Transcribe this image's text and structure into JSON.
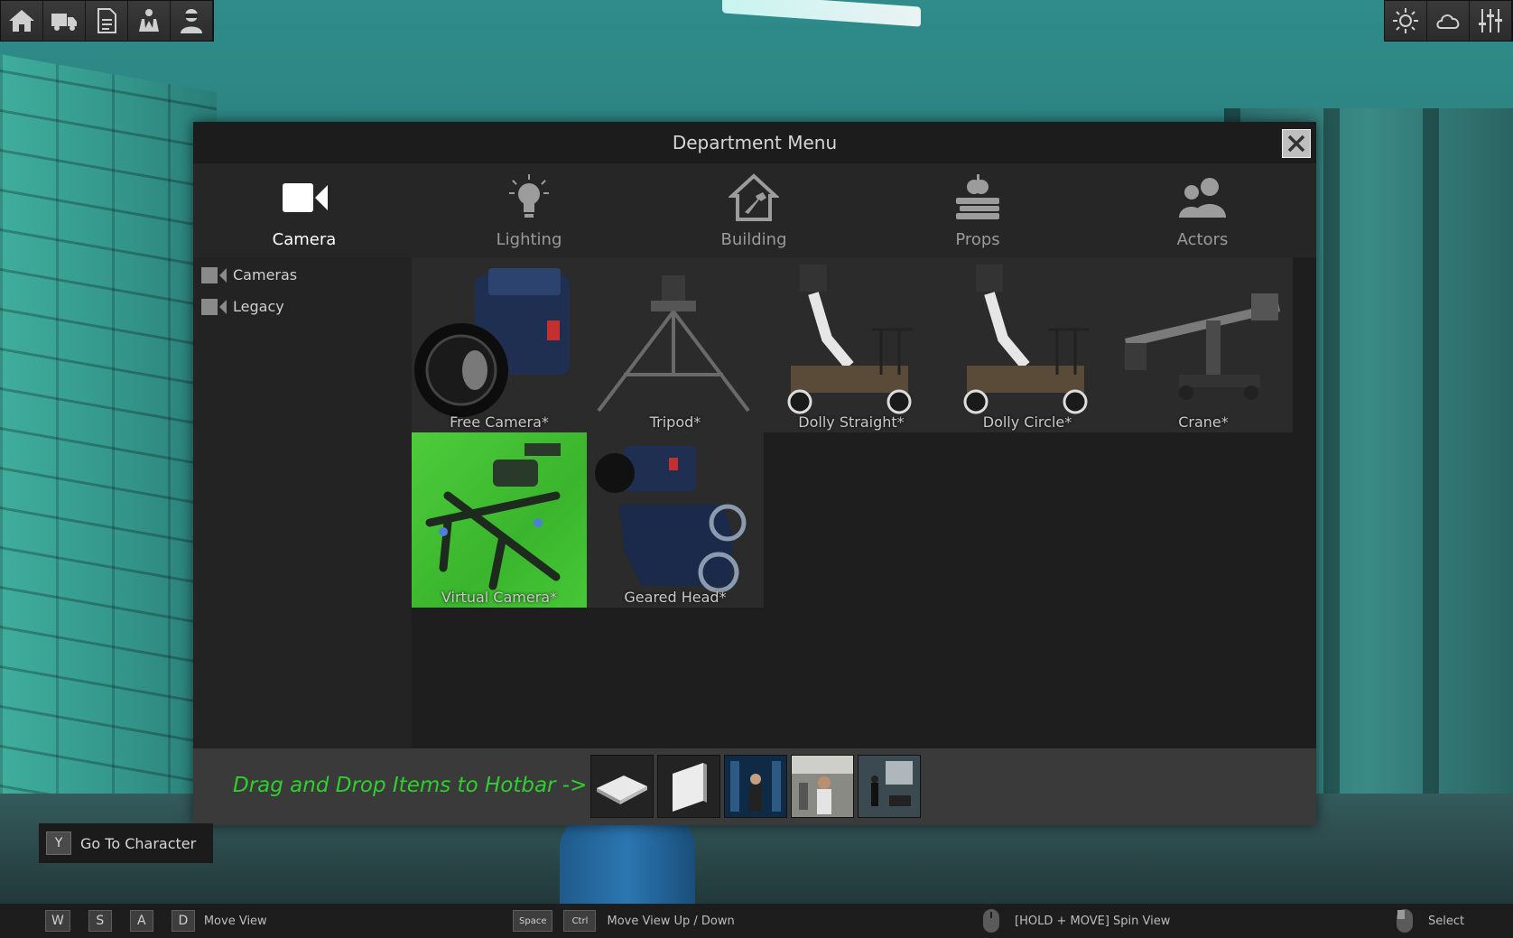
{
  "menu": {
    "title": "Department Menu"
  },
  "categories": [
    {
      "label": "Camera",
      "icon": "camera-icon",
      "active": true
    },
    {
      "label": "Lighting",
      "icon": "lightbulb-icon",
      "active": false
    },
    {
      "label": "Building",
      "icon": "house-hammer-icon",
      "active": false
    },
    {
      "label": "Props",
      "icon": "apple-books-icon",
      "active": false
    },
    {
      "label": "Actors",
      "icon": "people-icon",
      "active": false
    }
  ],
  "sidebar": {
    "items": [
      {
        "label": "Cameras",
        "icon": "camera-icon"
      },
      {
        "label": "Legacy",
        "icon": "camera-icon"
      }
    ]
  },
  "items": [
    {
      "label": "Free Camera*"
    },
    {
      "label": "Tripod*"
    },
    {
      "label": "Dolly Straight*"
    },
    {
      "label": "Dolly Circle*"
    },
    {
      "label": "Crane*"
    },
    {
      "label": "Virtual Camera*"
    },
    {
      "label": "Geared Head*"
    }
  ],
  "hotbar": {
    "hint": "Drag and Drop Items to Hotbar ->"
  },
  "go_to_character": {
    "key": "Y",
    "label": "Go To Character"
  },
  "bottom_help": {
    "keys_move": [
      "W",
      "S",
      "A",
      "D"
    ],
    "move_view": "Move View",
    "space_key": "Space",
    "ctrl_key": "Ctrl",
    "move_up_down": "Move View Up / Down",
    "spin_view": "[HOLD + MOVE] Spin View",
    "select": "Select"
  },
  "colors": {
    "hint_green": "#2fcf2f",
    "panel": "#262626",
    "virtual_camera_bg": "#45c436"
  }
}
